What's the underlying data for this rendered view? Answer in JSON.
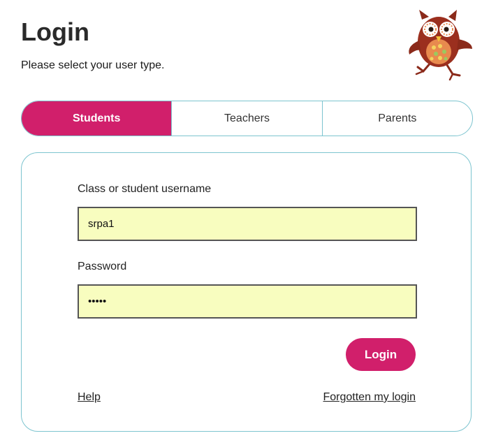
{
  "header": {
    "title": "Login",
    "subtitle": "Please select your user type."
  },
  "mascot": {
    "icon": "owl-mascot-icon"
  },
  "user_types": {
    "tabs": [
      {
        "label": "Students",
        "active": true
      },
      {
        "label": "Teachers",
        "active": false
      },
      {
        "label": "Parents",
        "active": false
      }
    ]
  },
  "form": {
    "username_label": "Class or student username",
    "username_value": "srpa1",
    "password_label": "Password",
    "password_value": "•••••",
    "login_label": "Login",
    "help_label": "Help",
    "forgotten_label": "Forgotten my login"
  },
  "colors": {
    "accent": "#d11f6b",
    "border": "#7cc4cf",
    "input_background": "#f8fdbf"
  }
}
